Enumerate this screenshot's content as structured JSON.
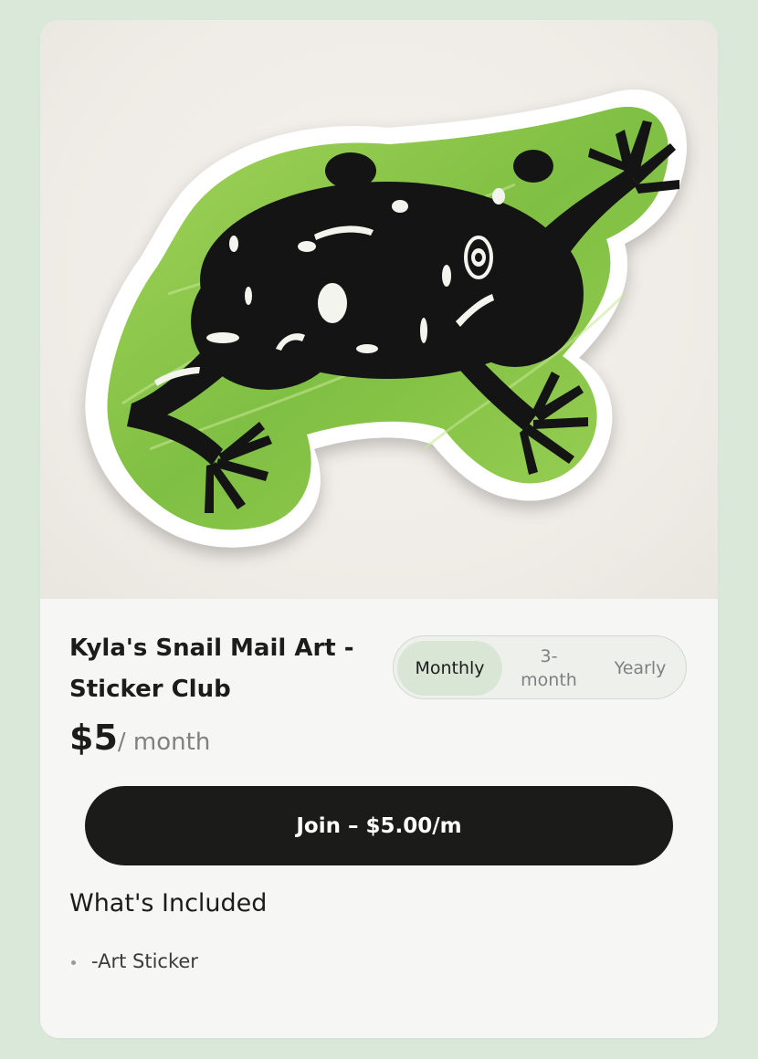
{
  "product": {
    "image_subject": "frog sticker",
    "title": "Kyla's Snail Mail Art - Sticker Club",
    "price": "$5",
    "period": "/ month"
  },
  "billing_toggle": {
    "options": [
      "Monthly",
      "3-\nmonth",
      "Yearly"
    ],
    "selected": "Monthly"
  },
  "join_button": {
    "label": "Join – $5.00/m"
  },
  "included": {
    "heading": "What's Included",
    "items": [
      "-Art Sticker"
    ]
  },
  "colors": {
    "page_background": "#d9e8d8",
    "card_background": "#f6f7f4",
    "button_background": "#1b1b1a",
    "toggle_active": "#d9e6d6",
    "sticker_green": "#86c34a"
  }
}
